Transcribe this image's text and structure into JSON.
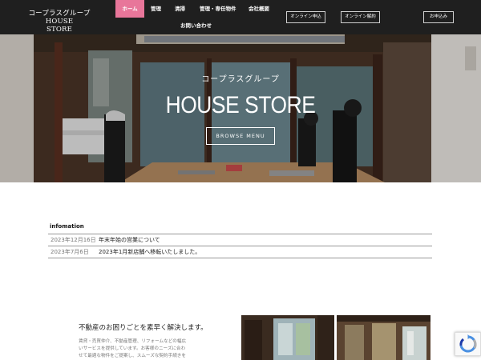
{
  "header": {
    "logo_line1": "コープラスグループ HOUSE",
    "logo_line2": "STORE",
    "nav": {
      "home": "ホーム",
      "management": "管理",
      "cleaning": "清掃",
      "properties": "管理・専任物件",
      "company": "会社概要",
      "contact": "お問い合わせ"
    },
    "buttons": {
      "online_apply": "オンライン申込",
      "online_contract": "オンライン解約",
      "application": "お申込み"
    }
  },
  "hero": {
    "subtitle": "コープラスグループ",
    "title": "HOUSE STORE",
    "button": "BROWSE MENU"
  },
  "info": {
    "title": "infomation",
    "items": [
      {
        "date": "2023年12月16日",
        "text": "年末年始の営業について"
      },
      {
        "date": "2023年7月6日",
        "text": "2023年1月新店舗へ移転いたしました。"
      }
    ]
  },
  "about": {
    "title": "不動産のお困りごとを素早く解決します。",
    "body_line1": "賃貸・売買仲介、不動産管理、リフォームなどの幅広",
    "body_line2": "いサービスを提供しています。お客様のニーズに合わ",
    "body_line3": "せて最適な物件をご提案し、スムーズな契約手続きを"
  },
  "colors": {
    "header_bg": "#1f1f1f",
    "accent_pink": "#e8769a"
  }
}
